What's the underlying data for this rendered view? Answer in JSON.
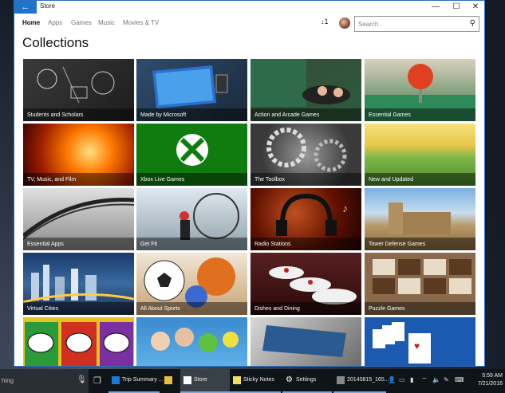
{
  "window": {
    "title": "Store",
    "back_glyph": "←",
    "minimize_glyph": "—",
    "maximize_glyph": "☐",
    "close_glyph": "✕"
  },
  "nav": {
    "items": [
      "Home",
      "Apps",
      "Games",
      "Music",
      "Movies & TV"
    ],
    "active": "Home",
    "downloads_label": "↓1",
    "search_placeholder": "Search"
  },
  "page": {
    "heading": "Collections"
  },
  "tiles": [
    {
      "label": "Students and Scholars"
    },
    {
      "label": "Made by Microsoft"
    },
    {
      "label": "Action and Arcade Games"
    },
    {
      "label": "Essential Games"
    },
    {
      "label": "TV, Music, and Film"
    },
    {
      "label": "Xbox Live Games"
    },
    {
      "label": "The Toolbox"
    },
    {
      "label": "New and Updated"
    },
    {
      "label": "Essential Apps"
    },
    {
      "label": "Get Fit"
    },
    {
      "label": "Radio Stations"
    },
    {
      "label": "Tower Defense Games"
    },
    {
      "label": "Virtual Cities"
    },
    {
      "label": "All About Sports"
    },
    {
      "label": "Dishes and Dining"
    },
    {
      "label": "Puzzle Games"
    },
    {
      "label": ""
    },
    {
      "label": ""
    },
    {
      "label": ""
    },
    {
      "label": ""
    }
  ],
  "taskbar": {
    "search_text": "hing",
    "apps": [
      {
        "label": "Trip Summary ..."
      },
      {
        "label": ""
      },
      {
        "label": "Store"
      },
      {
        "label": "Sticky Notes"
      },
      {
        "label": "Settings"
      },
      {
        "label": "20140815_165..."
      }
    ],
    "time": "5:59 AM",
    "date": "7/21/2016"
  },
  "colors": {
    "accent": "#1f73c9",
    "xbox_green": "#107c10"
  }
}
